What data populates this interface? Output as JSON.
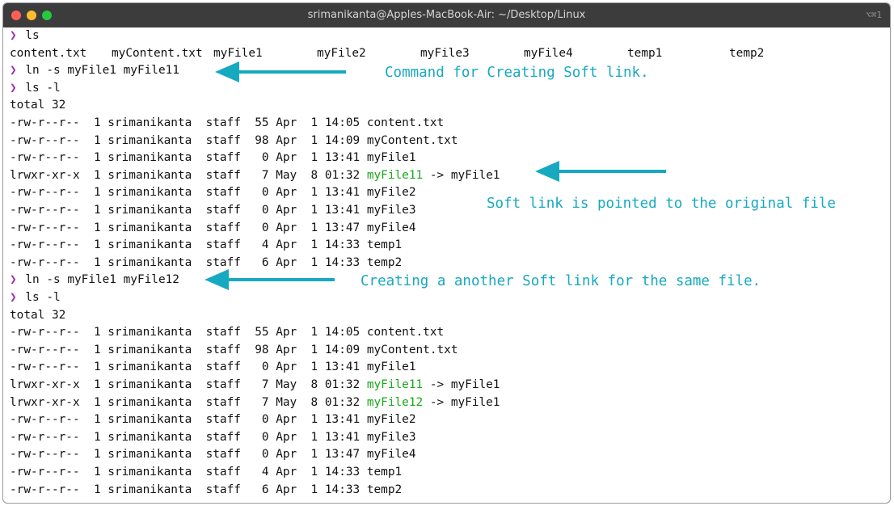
{
  "window": {
    "title": "srimanikanta@Apples-MacBook-Air: ~/Desktop/Linux",
    "shortcut": "⌥⌘1"
  },
  "prompt_symbol": "❯",
  "session": [
    {
      "cmd": "ls"
    },
    {
      "ls_row": [
        "content.txt",
        "myContent.txt",
        "myFile1",
        "myFile2",
        "myFile3",
        "myFile4",
        "temp1",
        "temp2"
      ]
    },
    {
      "cmd": "ln -s myFile1 myFile11"
    },
    {
      "cmd": "ls -l"
    },
    {
      "text": "total 32"
    },
    {
      "text": "-rw-r--r--  1 srimanikanta  staff  55 Apr  1 14:05 content.txt"
    },
    {
      "text": "-rw-r--r--  1 srimanikanta  staff  98 Apr  1 14:09 myContent.txt"
    },
    {
      "text": "-rw-r--r--  1 srimanikanta  staff   0 Apr  1 13:41 myFile1"
    },
    {
      "text": "lrwxr-xr-x  1 srimanikanta  staff   7 May  8 01:32 ",
      "link": "myFile11",
      "target": " -> myFile1"
    },
    {
      "text": "-rw-r--r--  1 srimanikanta  staff   0 Apr  1 13:41 myFile2"
    },
    {
      "text": "-rw-r--r--  1 srimanikanta  staff   0 Apr  1 13:41 myFile3"
    },
    {
      "text": "-rw-r--r--  1 srimanikanta  staff   0 Apr  1 13:47 myFile4"
    },
    {
      "text": "-rw-r--r--  1 srimanikanta  staff   4 Apr  1 14:33 temp1"
    },
    {
      "text": "-rw-r--r--  1 srimanikanta  staff   6 Apr  1 14:33 temp2"
    },
    {
      "cmd": "ln -s myFile1 myFile12"
    },
    {
      "cmd": "ls -l"
    },
    {
      "text": "total 32"
    },
    {
      "text": "-rw-r--r--  1 srimanikanta  staff  55 Apr  1 14:05 content.txt"
    },
    {
      "text": "-rw-r--r--  1 srimanikanta  staff  98 Apr  1 14:09 myContent.txt"
    },
    {
      "text": "-rw-r--r--  1 srimanikanta  staff   0 Apr  1 13:41 myFile1"
    },
    {
      "text": "lrwxr-xr-x  1 srimanikanta  staff   7 May  8 01:32 ",
      "link": "myFile11",
      "target": " -> myFile1"
    },
    {
      "text": "lrwxr-xr-x  1 srimanikanta  staff   7 May  8 01:32 ",
      "link": "myFile12",
      "target": " -> myFile1"
    },
    {
      "text": "-rw-r--r--  1 srimanikanta  staff   0 Apr  1 13:41 myFile2"
    },
    {
      "text": "-rw-r--r--  1 srimanikanta  staff   0 Apr  1 13:41 myFile3"
    },
    {
      "text": "-rw-r--r--  1 srimanikanta  staff   0 Apr  1 13:47 myFile4"
    },
    {
      "text": "-rw-r--r--  1 srimanikanta  staff   4 Apr  1 14:33 temp1"
    },
    {
      "text": "-rw-r--r--  1 srimanikanta  staff   6 Apr  1 14:33 temp2"
    }
  ],
  "annotations": {
    "create_soft_link": "Command for Creating Soft link.",
    "soft_link_pointed": "Soft link is pointed to the original file",
    "another_soft_link": "Creating a another Soft link for the same file."
  },
  "colors": {
    "prompt": "#9b2fa8",
    "symlink": "#1aa81a",
    "annotation": "#17a9c0",
    "titlebar": "#3c3c3c"
  }
}
